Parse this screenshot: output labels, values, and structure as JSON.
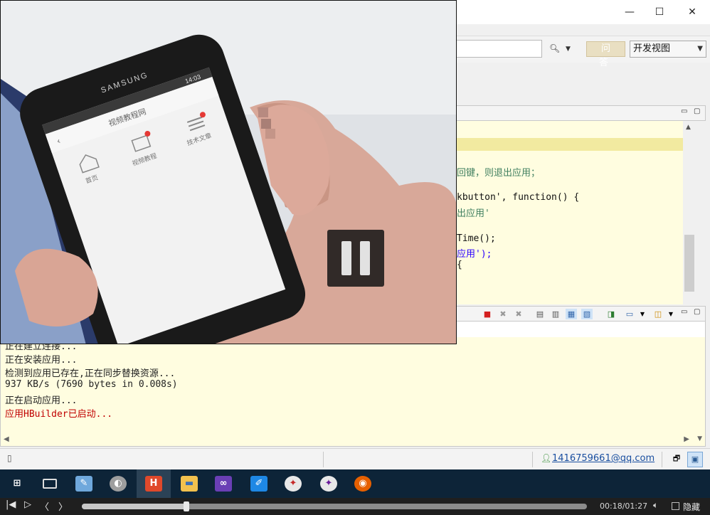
{
  "window": {
    "close_glyph": "✕",
    "maximize_glyph": "☐",
    "minimize_glyph": "—"
  },
  "toolbar": {
    "qa_label": "问 答",
    "view_selected": "开发视图"
  },
  "editor": {
    "lines": [
      "回键，则退出应用；",
      "kbutton', function() {",
      "出应用'",
      "Time();",
      "应用');",
      "{"
    ]
  },
  "console": {
    "lines": [
      "正在建立连接...",
      "正在安装应用...",
      "检测到应用已存在,正在同步替换资源...",
      "937 KB/s (7690 bytes in 0.008s)",
      "正在启动应用...",
      "应用HBuilder已启动..."
    ]
  },
  "status": {
    "user_email": "1416759661@qq.com"
  },
  "taskbar": {
    "items": [
      "windows-start",
      "task-view",
      "paint",
      "media",
      "hbuilder",
      "file-explorer",
      "visual-studio",
      "notes",
      "app-a",
      "app-b",
      "firefox"
    ],
    "hbuilder_label": "H"
  },
  "player": {
    "time": "00:18/01:27",
    "progress_fraction": 0.207,
    "hide_label": "隐藏",
    "state": "paused"
  },
  "video_phone": {
    "brand": "SAMSUNG",
    "clock": "14:03",
    "app_title": "视频教程网",
    "nav_items": [
      "首页",
      "视频教程",
      "技术文章"
    ]
  },
  "colors": {
    "editor_bg": "#fffde0",
    "taskbar_bg": "#0d2438",
    "error_text": "#c00000",
    "link": "#1a4fa0"
  }
}
